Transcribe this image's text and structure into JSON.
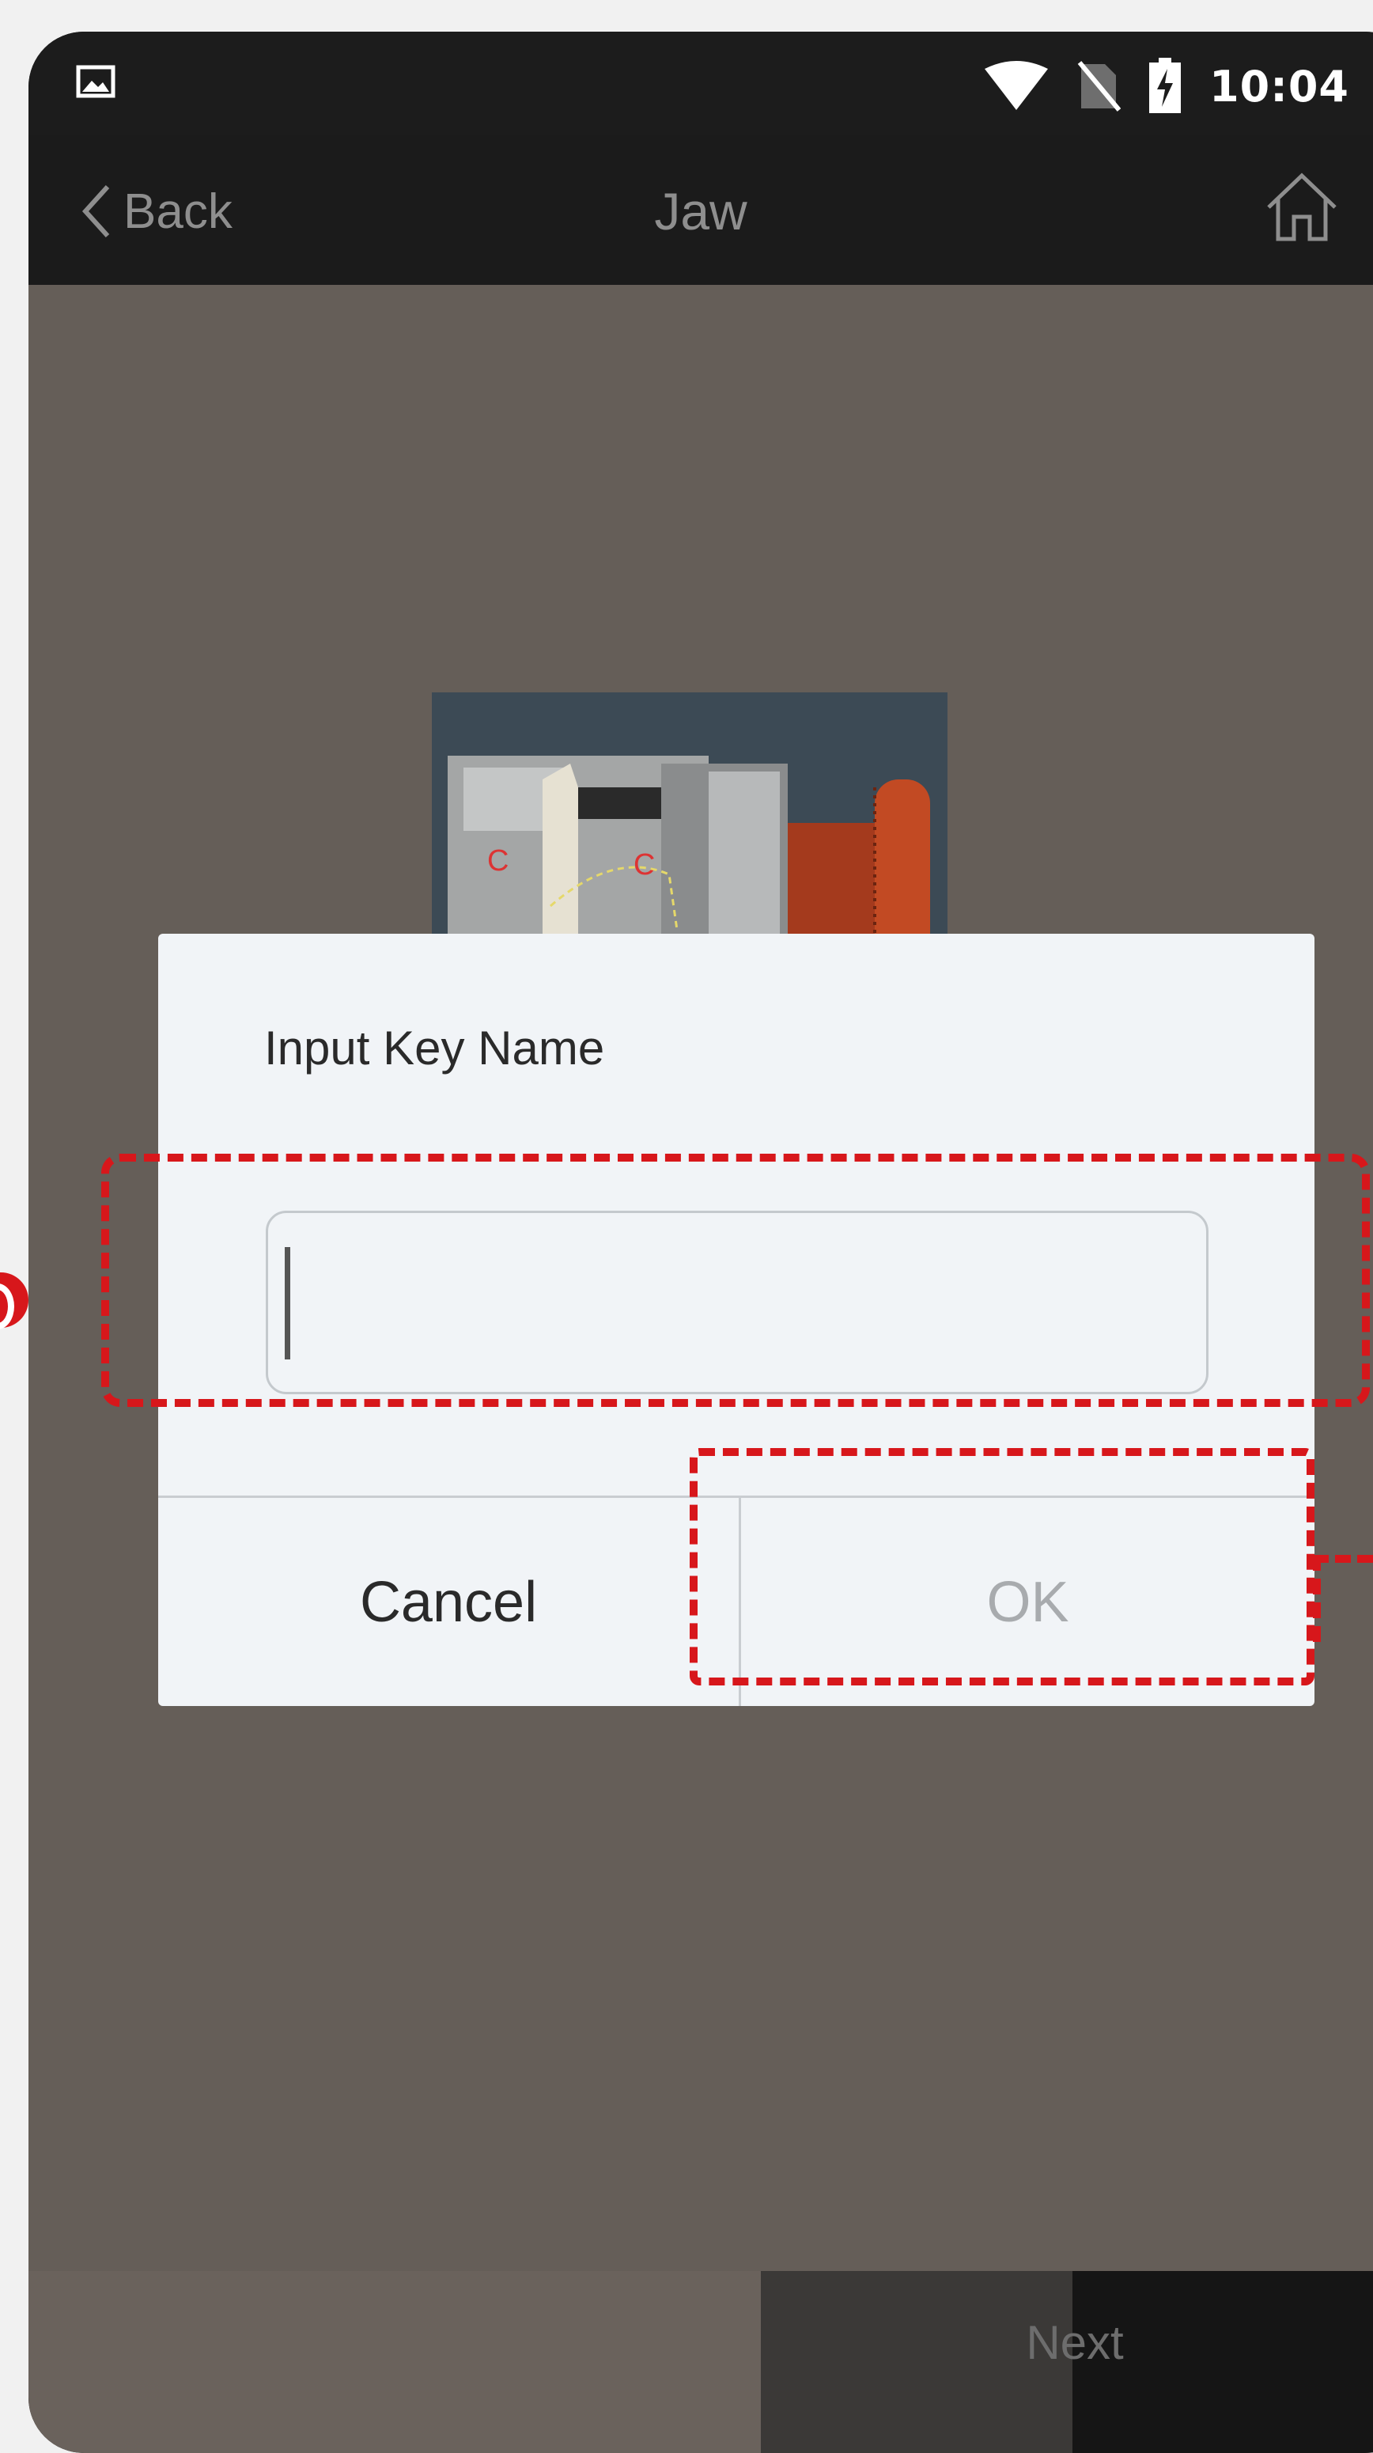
{
  "status_bar": {
    "time": "10:04",
    "icons": [
      "image-icon",
      "wifi-icon",
      "no-sim-icon",
      "battery-charging-icon"
    ]
  },
  "app_bar": {
    "back_label": "Back",
    "title": "Jaw",
    "home_icon": "home-icon"
  },
  "dialog": {
    "title": "Input Key Name",
    "input_value": "",
    "cancel_label": "Cancel",
    "ok_label": "OK"
  },
  "bottom_bar": {
    "next_label": "Next"
  },
  "jaw_image": {
    "labels": [
      "C",
      "C"
    ]
  },
  "colors": {
    "highlight": "#d7171b",
    "dialog_bg": "#f1f4f7",
    "ok_disabled": "#a8abae"
  }
}
